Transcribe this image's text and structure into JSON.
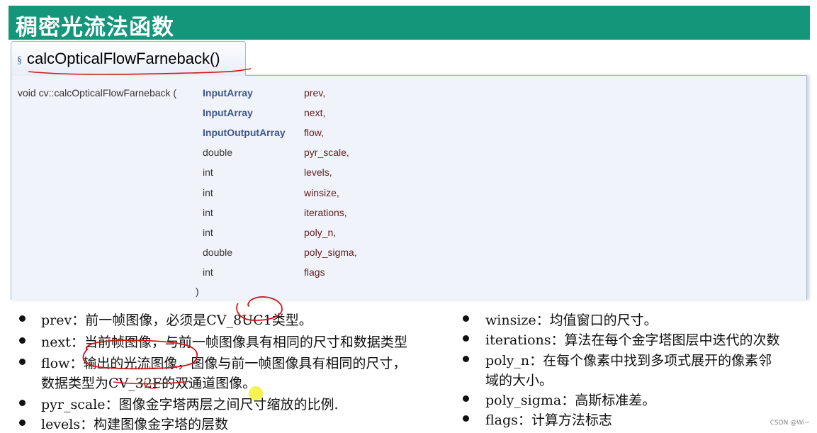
{
  "header": {
    "title": "稠密光流法函数"
  },
  "tab": {
    "section_symbol": "§",
    "function_name": "calcOpticalFlowFarneback()"
  },
  "declaration": {
    "prefix": "void cv::calcOpticalFlowFarneback (",
    "params": [
      {
        "type": "InputArray",
        "name": "prev,",
        "linked": true
      },
      {
        "type": "InputArray",
        "name": "next,",
        "linked": true
      },
      {
        "type": "InputOutputArray",
        "name": "flow,",
        "linked": true
      },
      {
        "type": "double",
        "name": "pyr_scale,",
        "linked": false
      },
      {
        "type": "int",
        "name": "levels,",
        "linked": false
      },
      {
        "type": "int",
        "name": "winsize,",
        "linked": false
      },
      {
        "type": "int",
        "name": "iterations,",
        "linked": false
      },
      {
        "type": "int",
        "name": "poly_n,",
        "linked": false
      },
      {
        "type": "double",
        "name": "poly_sigma,",
        "linked": false
      },
      {
        "type": "int",
        "name": "flags",
        "linked": false
      }
    ],
    "close": ")"
  },
  "bullets_left": [
    {
      "lines": [
        "prev：前一帧图像，必须是CV_8UC1类型。"
      ]
    },
    {
      "lines": [
        "next：当前帧图像，与前一帧图像具有相同的尺寸和数据类型"
      ]
    },
    {
      "lines": [
        "flow：输出的光流图像，图像与前一帧图像具有相同的尺寸，",
        "数据类型为CV_32F的双通道图像。"
      ]
    },
    {
      "lines": [
        "pyr_scale：图像金字塔两层之间尺寸缩放的比例."
      ]
    },
    {
      "lines": [
        "levels：构建图像金字塔的层数"
      ]
    }
  ],
  "bullets_right": [
    {
      "lines": [
        "winsize：均值窗口的尺寸。"
      ]
    },
    {
      "lines": [
        "iterations：算法在每个金字塔图层中迭代的次数"
      ]
    },
    {
      "lines": [
        "poly_n：在每个像素中找到多项式展开的像素邻",
        "域的大小。"
      ]
    },
    {
      "lines": [
        "poly_sigma：高斯标准差。"
      ]
    },
    {
      "lines": [
        "flags：计算方法标志"
      ]
    }
  ],
  "watermark": "CSDN @Wi~",
  "colors": {
    "title_bg": "#13967a",
    "panel_bg": "#f0f3fa",
    "param_type_link": "#3d578c",
    "param_name": "#602020",
    "annotation_red": "#d21818",
    "highlight_yellow": "#f5f032"
  }
}
